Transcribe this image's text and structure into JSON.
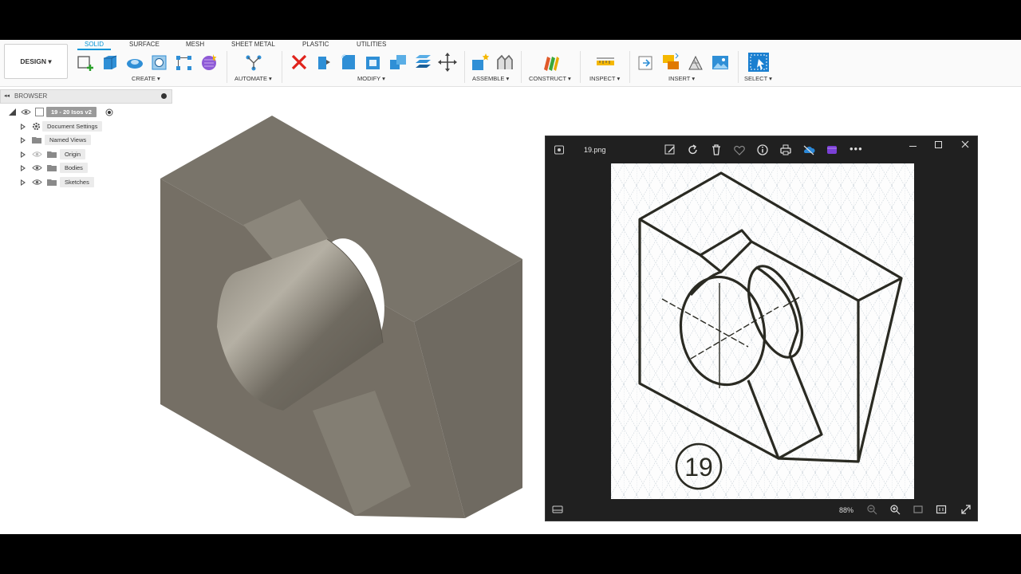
{
  "app": {
    "design_label": "DESIGN ▾",
    "tabs": [
      {
        "label": "SOLID",
        "active": true
      },
      {
        "label": "SURFACE",
        "active": false
      },
      {
        "label": "MESH",
        "active": false
      },
      {
        "label": "SHEET METAL",
        "active": false
      },
      {
        "label": "PLASTIC",
        "active": false
      },
      {
        "label": "UTILITIES",
        "active": false
      }
    ],
    "groups": {
      "create": "CREATE ▾",
      "automate": "AUTOMATE ▾",
      "modify": "MODIFY ▾",
      "assemble": "ASSEMBLE ▾",
      "construct": "CONSTRUCT ▾",
      "inspect": "INSPECT ▾",
      "insert": "INSERT ▾",
      "select": "SELECT ▾"
    },
    "colors": {
      "accent": "#0696d7",
      "body": "#7a756b"
    }
  },
  "browser": {
    "title": "BROWSER",
    "root": "19 - 20 Isos v2",
    "items": [
      {
        "label": "Document Settings",
        "icon": "gear-icon"
      },
      {
        "label": "Named Views",
        "icon": "folder-icon"
      },
      {
        "label": "Origin",
        "icon": "folder-icon"
      },
      {
        "label": "Bodies",
        "icon": "folder-icon"
      },
      {
        "label": "Sketches",
        "icon": "folder-icon"
      }
    ]
  },
  "viewer": {
    "filename": "19.png",
    "zoom": "88%",
    "figure_number": "19"
  }
}
